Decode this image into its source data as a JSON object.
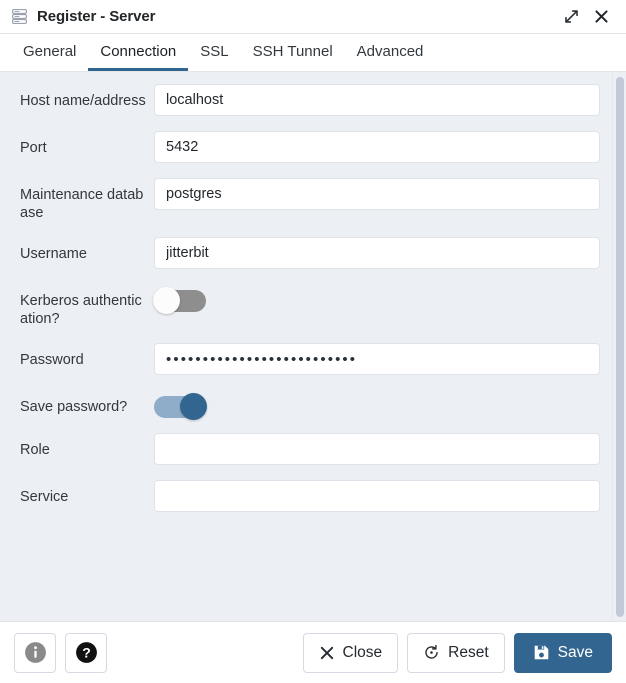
{
  "window": {
    "title": "Register - Server",
    "icon": "server-icon",
    "maximize_icon": "expand-diagonal-icon",
    "close_icon": "close-icon"
  },
  "tabs": [
    {
      "label": "General",
      "active": false
    },
    {
      "label": "Connection",
      "active": true
    },
    {
      "label": "SSL",
      "active": false
    },
    {
      "label": "SSH Tunnel",
      "active": false
    },
    {
      "label": "Advanced",
      "active": false
    }
  ],
  "form": {
    "fields": [
      {
        "label": "Host name/address",
        "type": "text",
        "value": "localhost",
        "placeholder": ""
      },
      {
        "label": "Port",
        "type": "text",
        "value": "5432",
        "placeholder": ""
      },
      {
        "label": "Maintenance database",
        "type": "text",
        "value": "postgres",
        "placeholder": ""
      },
      {
        "label": "Username",
        "type": "text",
        "value": "jitterbit",
        "placeholder": ""
      },
      {
        "label": "Kerberos authentication?",
        "type": "toggle",
        "value": "off"
      },
      {
        "label": "Password",
        "type": "password",
        "value": "••••••••••••••••••••••••••"
      },
      {
        "label": "Save password?",
        "type": "toggle",
        "value": "on"
      },
      {
        "label": "Role",
        "type": "text",
        "value": "",
        "placeholder": ""
      },
      {
        "label": "Service",
        "type": "text",
        "value": "",
        "placeholder": ""
      }
    ]
  },
  "footer": {
    "info_icon": "info-icon",
    "help_icon": "help-icon",
    "close_label": "Close",
    "reset_label": "Reset",
    "save_label": "Save"
  },
  "colors": {
    "accent": "#326690",
    "form_background": "#eceff4",
    "toggle_off_track": "#8e8e8e",
    "toggle_on_track": "#8fadc8"
  }
}
